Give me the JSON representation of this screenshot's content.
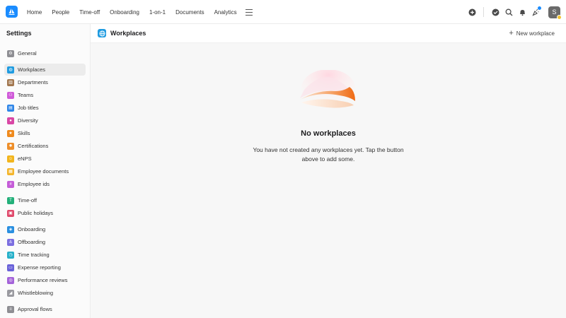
{
  "nav": {
    "items": [
      "Home",
      "People",
      "Time-off",
      "Onboarding",
      "1-on-1",
      "Documents",
      "Analytics"
    ]
  },
  "user": {
    "initial": "S"
  },
  "colors": {
    "accent": "#1a8cff",
    "illustration": "#f07a2a"
  },
  "sidebar": {
    "title": "Settings",
    "items": [
      {
        "label": "General",
        "icon": "gear-icon",
        "color": "#8e8e93"
      },
      {
        "label": "Workplaces",
        "icon": "globe-icon",
        "color": "#1f9be0"
      },
      {
        "label": "Departments",
        "icon": "building-icon",
        "color": "#a2774f"
      },
      {
        "label": "Teams",
        "icon": "team-icon",
        "color": "#d05ad9"
      },
      {
        "label": "Job titles",
        "icon": "id-card-icon",
        "color": "#2f86e8"
      },
      {
        "label": "Diversity",
        "icon": "person-icon",
        "color": "#d947a5"
      },
      {
        "label": "Skills",
        "icon": "star-icon",
        "color": "#ef8a1d"
      },
      {
        "label": "Certifications",
        "icon": "certificate-icon",
        "color": "#ee8f2b"
      },
      {
        "label": "eNPS",
        "icon": "smiley-icon",
        "color": "#f2b51d"
      },
      {
        "label": "Employee documents",
        "icon": "document-icon",
        "color": "#f4b52b"
      },
      {
        "label": "Employee ids",
        "icon": "hash-icon",
        "color": "#c55dd8"
      },
      {
        "label": "Time-off",
        "icon": "palm-tree-icon",
        "color": "#23b07a"
      },
      {
        "label": "Public holidays",
        "icon": "calendar-icon",
        "color": "#e0496b"
      },
      {
        "label": "Onboarding",
        "icon": "onboarding-icon",
        "color": "#2a8fe0"
      },
      {
        "label": "Offboarding",
        "icon": "anchor-icon",
        "color": "#7b6ee0"
      },
      {
        "label": "Time tracking",
        "icon": "clock-icon",
        "color": "#26b0c9"
      },
      {
        "label": "Expense reporting",
        "icon": "receipt-icon",
        "color": "#6a62d9"
      },
      {
        "label": "Performance reviews",
        "icon": "review-icon",
        "color": "#a463d9"
      },
      {
        "label": "Whistleblowing",
        "icon": "megaphone-icon",
        "color": "#9a9aa0"
      },
      {
        "label": "Approval flows",
        "icon": "flow-icon",
        "color": "#8e8e93"
      }
    ]
  },
  "main": {
    "title": "Workplaces",
    "new_button": "New workplace",
    "empty_title": "No workplaces",
    "empty_text": "You have not created any workplaces yet. Tap the button above to add some."
  }
}
